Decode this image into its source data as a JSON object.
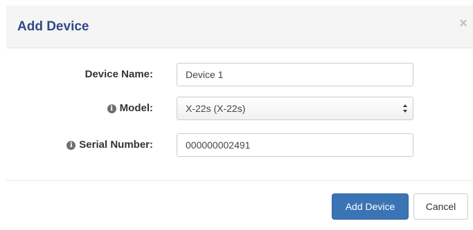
{
  "modal": {
    "title": "Add Device",
    "close_glyph": "×",
    "close_icon": "close-icon"
  },
  "form": {
    "device_name": {
      "label": "Device Name:",
      "value": "Device 1"
    },
    "model": {
      "label": "Model:",
      "value": "X-22s (X-22s)",
      "info_icon": "info-circle-icon"
    },
    "serial_number": {
      "label": "Serial Number:",
      "value": "000000002491",
      "info_icon": "info-circle-icon"
    }
  },
  "footer": {
    "primary_label": "Add Device",
    "cancel_label": "Cancel"
  },
  "colors": {
    "title": "#2f4a86",
    "primary": "#3a74b5",
    "header_bg": "#f5f5f5"
  }
}
